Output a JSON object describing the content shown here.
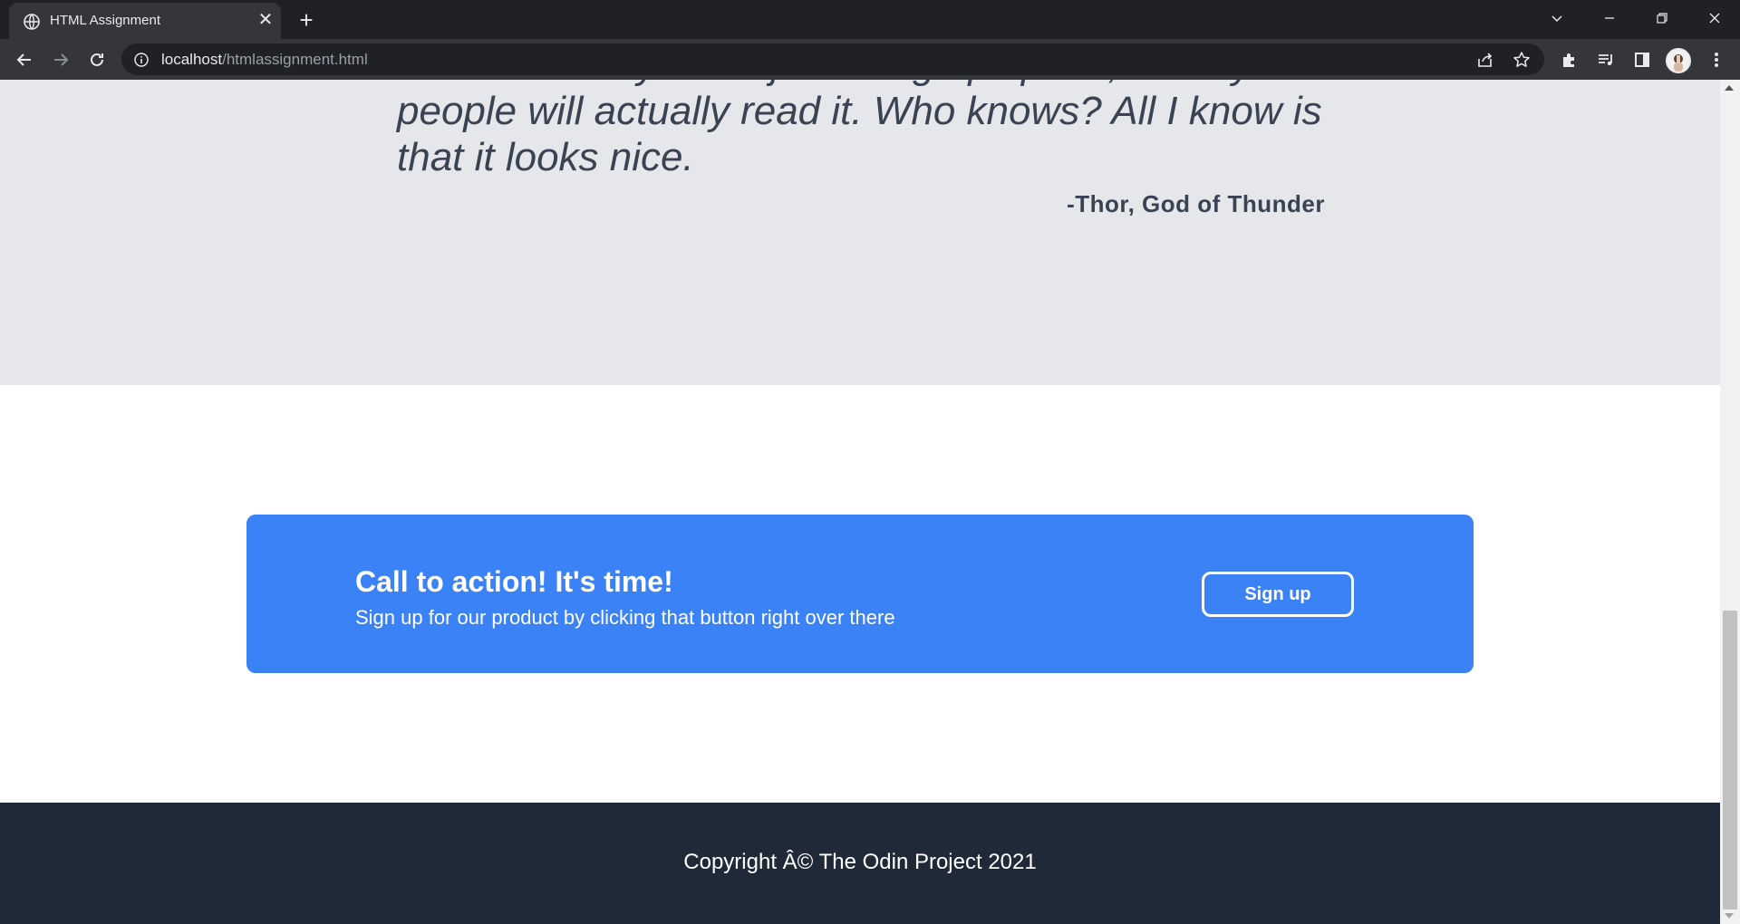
{
  "browser": {
    "tab_title": "HTML Assignment",
    "tab_close": "✕",
    "new_tab": "+",
    "url_host": "localhost",
    "url_path": "/htmlassignment.html"
  },
  "quote": {
    "text": "customer. Maybe it's just filling up space, or maybe people will actually read it. Who knows? All I know is that it looks nice.",
    "author": "-Thor, God of Thunder"
  },
  "cta": {
    "heading": "Call to action! It's time!",
    "subtext": "Sign up for our product by clicking that button right over there",
    "button_label": "Sign up"
  },
  "footer": {
    "text": "Copyright Â© The Odin Project 2021"
  },
  "colors": {
    "quote_bg": "#e5e7eb",
    "cta_bg": "#3b82f6",
    "footer_bg": "#1f2937",
    "chrome_dark": "#202124"
  }
}
